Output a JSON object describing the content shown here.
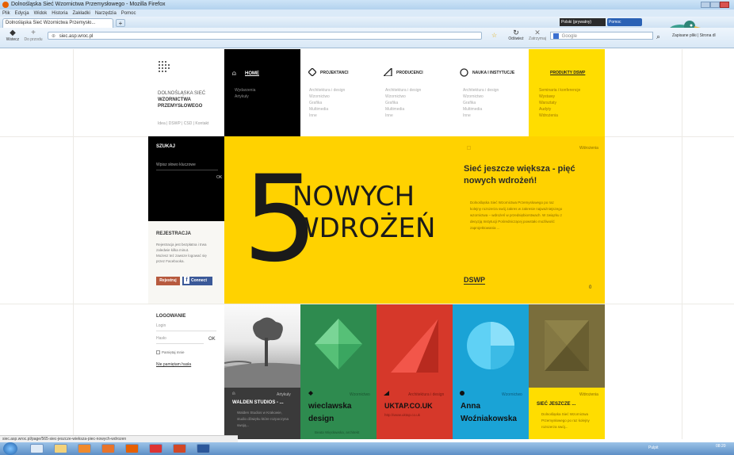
{
  "browser": {
    "title": "Dolnośląska Sieć Wzornictwa Przemysłowego - Mozilla Firefox",
    "menu": [
      "Plik",
      "Edycja",
      "Widok",
      "Historia",
      "Zakładki",
      "Narzędzia",
      "Pomoc"
    ],
    "tab_label": "Dolnośląska Sieć Wzornictwa Przemysło...",
    "url": "siec.asp.wroc.pl",
    "back_label": "Wstecz",
    "forward_label": "Do przodu",
    "reload_label": "Odśwież",
    "stop_label": "Zatrzymaj",
    "search_placeholder": "Google",
    "toolbar_right": [
      "Polski (prywatny)",
      "Pomoc"
    ],
    "toolbar_far_right": "Zapisane pliki | Strona dl",
    "status_url": "siec.asp.wroc.pl/page/565-siec-jeszcze-wieksza-piec-nowych-wdrozen"
  },
  "site": {
    "logo_lines": [
      "DOLNOŚLĄSKA SIEĆ",
      "WZORNICTWA",
      "PRZEMYSŁOWEGO"
    ],
    "logo_links": "Idea | DSWP | CSD | Kontakt",
    "nav": [
      {
        "label": "HOME",
        "items": [
          "Wydarzenia",
          "Artykuły"
        ]
      },
      {
        "label": "PROJEKTANCI",
        "items": [
          "Architektura i design",
          "Wzornictwo",
          "Grafika",
          "Multimedia",
          "Inne"
        ]
      },
      {
        "label": "PRODUCENCI",
        "items": [
          "Architektura i design",
          "Wzornictwo",
          "Grafika",
          "Multimedia",
          "Inne"
        ]
      },
      {
        "label": "NAUKA I INSTYTUCJE",
        "items": [
          "Architektura i design",
          "Wzornictwo",
          "Grafika",
          "Multimedia",
          "Inne"
        ]
      },
      {
        "label": "PRODUKTY DSWP",
        "items": [
          "Seminaria i konferencje",
          "Wystawy",
          "Warsztaty",
          "Audyty",
          "Wdrożenia"
        ]
      }
    ],
    "search": {
      "title": "SZUKAJ",
      "placeholder": "Wpisz słowo kluczowe",
      "ok": "OK"
    },
    "register": {
      "title": "REJESTRACJA",
      "text": [
        "Rejestracja jest bezpłatna i trwa",
        "zaledwie kilka minut.",
        "Możesz też zawsze logować się",
        "przez Facebooka."
      ],
      "btn": "Rejestruj",
      "fb": "Connect"
    },
    "login": {
      "title": "LOGOWANIE",
      "login_placeholder": "Login",
      "password_placeholder": "Hasło",
      "ok": "OK",
      "remember": "Pamiętaj mnie",
      "forgot": "Nie pamiętam hasła"
    },
    "hero": {
      "number": "5",
      "line1": "NOWYCH",
      "line2": "WDROŻEŃ",
      "category": "Wdrożenia",
      "headline": "Sieć jeszcze większa - pięć nowych wdrożeń!",
      "body": [
        "Dolnośląska Sieć Wzornictwa Przemysłowego po raz",
        "kolejny rozszerza swój zakres w zakresie najważniejszego",
        "wzornictwa – wdrożeń w przedsiębiorstwach. W związku z",
        "decyzją Instytucji Pośredniczącej powstało możliwość",
        "zaprojektowania ..."
      ],
      "tag": "DSWP",
      "counter": "0"
    },
    "tiles": [
      {
        "category": "Artykuły",
        "title": "WALDEN STUDIOS - ...",
        "text": [
          "Walden Studios w Krakowie,",
          "studio dźwięku które rozpoczyna",
          "swoją..."
        ]
      },
      {
        "category": "Wzornictwo",
        "title": "wieclawska design",
        "text": [
          "Beata Więcławska, architekt"
        ]
      },
      {
        "category": "Architektura i design",
        "title": "UKTAP.CO.UK",
        "text": [
          "http://www.uktap.co.uk"
        ]
      },
      {
        "category": "Wzornictwo",
        "title": "Anna Woźniakowska",
        "text": [
          ""
        ]
      },
      {
        "category": "Wdrożenia",
        "title": "SIEĆ JESZCZE ...",
        "text": [
          "Dolnośląska Sieć Wzornictwa",
          "Przemysłowego po raz kolejny",
          "rozszerza swój..."
        ]
      }
    ]
  },
  "taskbar": {
    "right_label": "Pulpit",
    "time": "08:20"
  },
  "colors": {
    "black": "#000000",
    "yellow": "#ffdd00",
    "green": "#2f8e4d",
    "red": "#d93a2c",
    "blue": "#1aa3d6",
    "olive": "#7a6e3c"
  }
}
